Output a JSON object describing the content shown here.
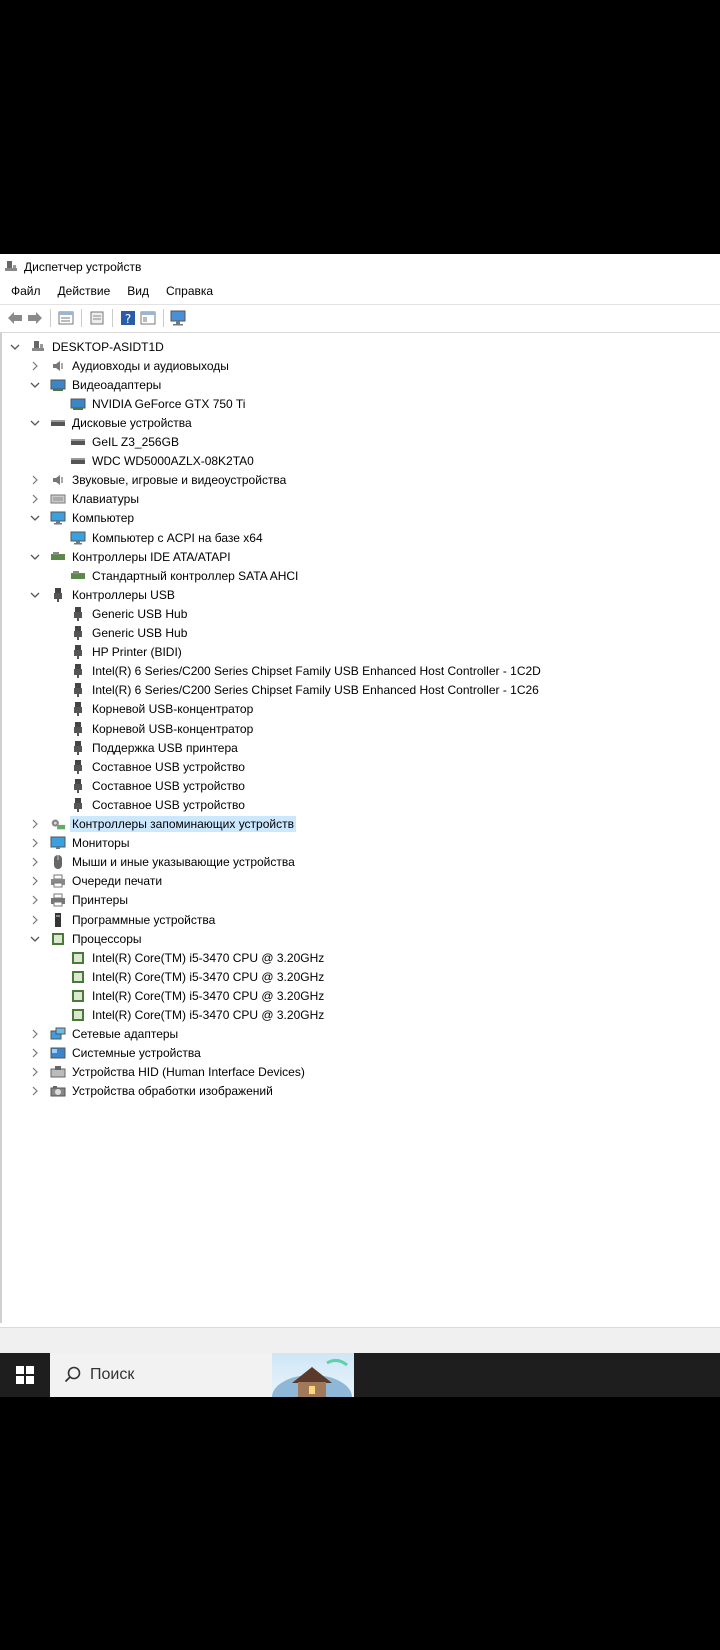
{
  "window": {
    "title": "Диспетчер устройств"
  },
  "menu": [
    "Файл",
    "Действие",
    "Вид",
    "Справка"
  ],
  "toolbar": [
    "back-icon",
    "forward-icon",
    "properties-icon",
    "update-icon",
    "help-icon",
    "view-icon",
    "monitor-scan-icon"
  ],
  "tree": [
    {
      "level": 0,
      "expander": "expanded",
      "icon": "computer-root-icon",
      "label": "DESKTOP-ASIDT1D"
    },
    {
      "level": 1,
      "expander": "collapsed",
      "icon": "audio-icon",
      "label": "Аудиовходы и аудиовыходы"
    },
    {
      "level": 1,
      "expander": "expanded",
      "icon": "display-adapter-icon",
      "label": "Видеоадаптеры"
    },
    {
      "level": 2,
      "expander": "none",
      "icon": "display-adapter-icon",
      "label": "NVIDIA GeForce GTX 750 Ti"
    },
    {
      "level": 1,
      "expander": "expanded",
      "icon": "disk-icon",
      "label": "Дисковые устройства"
    },
    {
      "level": 2,
      "expander": "none",
      "icon": "disk-icon",
      "label": "GeIL Z3_256GB"
    },
    {
      "level": 2,
      "expander": "none",
      "icon": "disk-icon",
      "label": "WDC WD5000AZLX-08K2TA0"
    },
    {
      "level": 1,
      "expander": "collapsed",
      "icon": "sound-icon",
      "label": "Звуковые, игровые и видеоустройства"
    },
    {
      "level": 1,
      "expander": "collapsed",
      "icon": "keyboard-icon",
      "label": "Клавиатуры"
    },
    {
      "level": 1,
      "expander": "expanded",
      "icon": "computer-icon",
      "label": "Компьютер"
    },
    {
      "level": 2,
      "expander": "none",
      "icon": "computer-icon",
      "label": "Компьютер с ACPI на базе x64"
    },
    {
      "level": 1,
      "expander": "expanded",
      "icon": "ide-controller-icon",
      "label": "Контроллеры IDE ATA/ATAPI"
    },
    {
      "level": 2,
      "expander": "none",
      "icon": "ide-controller-icon",
      "label": "Стандартный контроллер SATA AHCI"
    },
    {
      "level": 1,
      "expander": "expanded",
      "icon": "usb-icon",
      "label": "Контроллеры USB"
    },
    {
      "level": 2,
      "expander": "none",
      "icon": "usb-icon",
      "label": "Generic USB Hub"
    },
    {
      "level": 2,
      "expander": "none",
      "icon": "usb-icon",
      "label": "Generic USB Hub"
    },
    {
      "level": 2,
      "expander": "none",
      "icon": "usb-icon",
      "label": "HP Printer (BIDI)"
    },
    {
      "level": 2,
      "expander": "none",
      "icon": "usb-icon",
      "label": "Intel(R) 6 Series/C200 Series Chipset Family USB Enhanced Host Controller - 1C2D"
    },
    {
      "level": 2,
      "expander": "none",
      "icon": "usb-icon",
      "label": "Intel(R) 6 Series/C200 Series Chipset Family USB Enhanced Host Controller - 1C26"
    },
    {
      "level": 2,
      "expander": "none",
      "icon": "usb-icon",
      "label": "Корневой USB-концентратор"
    },
    {
      "level": 2,
      "expander": "none",
      "icon": "usb-icon",
      "label": "Корневой USB-концентратор"
    },
    {
      "level": 2,
      "expander": "none",
      "icon": "usb-icon",
      "label": "Поддержка USB принтера"
    },
    {
      "level": 2,
      "expander": "none",
      "icon": "usb-icon",
      "label": "Составное USB устройство"
    },
    {
      "level": 2,
      "expander": "none",
      "icon": "usb-icon",
      "label": "Составное USB устройство"
    },
    {
      "level": 2,
      "expander": "none",
      "icon": "usb-icon",
      "label": "Составное USB устройство"
    },
    {
      "level": 1,
      "expander": "collapsed",
      "icon": "storage-controller-icon",
      "label": "Контроллеры запоминающих устройств",
      "selected": true
    },
    {
      "level": 1,
      "expander": "collapsed",
      "icon": "monitor-icon",
      "label": "Мониторы"
    },
    {
      "level": 1,
      "expander": "collapsed",
      "icon": "mouse-icon",
      "label": "Мыши и иные указывающие устройства"
    },
    {
      "level": 1,
      "expander": "collapsed",
      "icon": "print-queue-icon",
      "label": "Очереди печати"
    },
    {
      "level": 1,
      "expander": "collapsed",
      "icon": "printer-icon",
      "label": "Принтеры"
    },
    {
      "level": 1,
      "expander": "collapsed",
      "icon": "software-device-icon",
      "label": "Программные устройства"
    },
    {
      "level": 1,
      "expander": "expanded",
      "icon": "processor-icon",
      "label": "Процессоры"
    },
    {
      "level": 2,
      "expander": "none",
      "icon": "processor-icon",
      "label": "Intel(R) Core(TM) i5-3470 CPU @ 3.20GHz"
    },
    {
      "level": 2,
      "expander": "none",
      "icon": "processor-icon",
      "label": "Intel(R) Core(TM) i5-3470 CPU @ 3.20GHz"
    },
    {
      "level": 2,
      "expander": "none",
      "icon": "processor-icon",
      "label": "Intel(R) Core(TM) i5-3470 CPU @ 3.20GHz"
    },
    {
      "level": 2,
      "expander": "none",
      "icon": "processor-icon",
      "label": "Intel(R) Core(TM) i5-3470 CPU @ 3.20GHz"
    },
    {
      "level": 1,
      "expander": "collapsed",
      "icon": "network-adapter-icon",
      "label": "Сетевые адаптеры"
    },
    {
      "level": 1,
      "expander": "collapsed",
      "icon": "system-device-icon",
      "label": "Системные устройства"
    },
    {
      "level": 1,
      "expander": "collapsed",
      "icon": "hid-icon",
      "label": "Устройства HID (Human Interface Devices)"
    },
    {
      "level": 1,
      "expander": "collapsed",
      "icon": "imaging-device-icon",
      "label": "Устройства обработки изображений"
    }
  ],
  "taskbar": {
    "search_label": "Поиск"
  },
  "colors": {
    "selection": "#cce8ff",
    "taskbar": "#1e1e1e"
  }
}
